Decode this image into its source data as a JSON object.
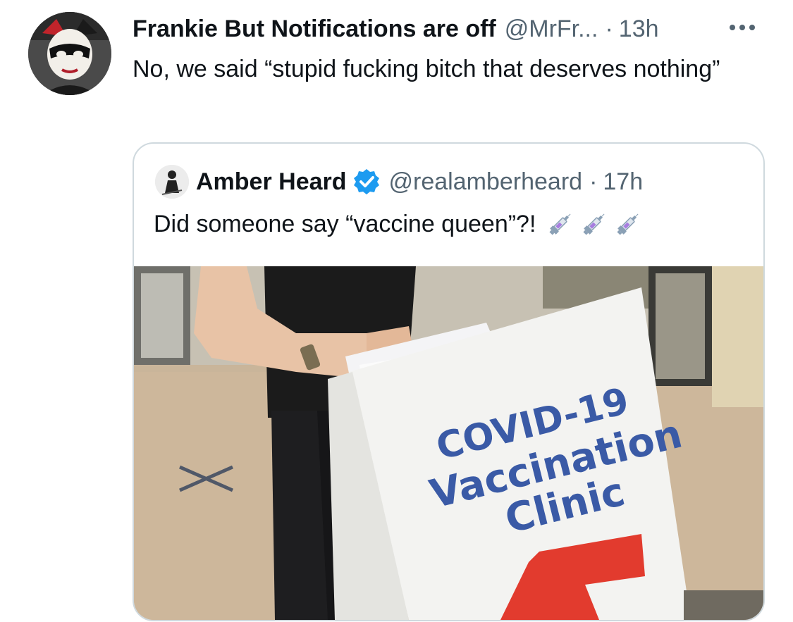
{
  "tweet": {
    "display_name": "Frankie But Notifications are off",
    "handle": "@MrFr...",
    "separator": "·",
    "time": "13h",
    "more_icon": "more-horizontal-icon",
    "text": "No, we said “stupid fucking bitch that deserves nothing”"
  },
  "quoted_tweet": {
    "display_name": "Amber Heard",
    "verified": true,
    "handle": "@realamberheard",
    "separator": "·",
    "time": "17h",
    "text": "Did someone say “vaccine queen”?!",
    "emoji": [
      "syringe",
      "syringe",
      "syringe"
    ],
    "photo": {
      "sign_line1": "COVID-19",
      "sign_line2": "Vaccination",
      "sign_line3": "Clinic"
    }
  },
  "colors": {
    "text_primary": "#0f1419",
    "text_secondary": "#536471",
    "verified_blue": "#1d9bf0",
    "card_border": "#cfd9de",
    "sign_blue": "#3a5aa6",
    "sign_arrow_red": "#e23b2e"
  }
}
